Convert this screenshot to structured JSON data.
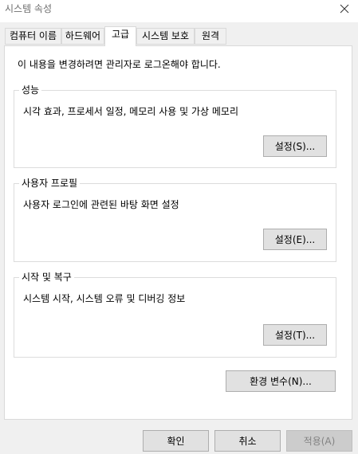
{
  "window": {
    "title": "시스템 속성"
  },
  "tabs": [
    {
      "label": "컴퓨터 이름"
    },
    {
      "label": "하드웨어"
    },
    {
      "label": "고급"
    },
    {
      "label": "시스템 보호"
    },
    {
      "label": "원격"
    }
  ],
  "active_tab": "고급",
  "notice": "이 내용을 변경하려면 관리자로 로그온해야 합니다.",
  "groups": {
    "performance": {
      "title": "성능",
      "description": "시각 효과, 프로세서 일정, 메모리 사용 및 가상 메모리",
      "button": "설정(S)..."
    },
    "user_profiles": {
      "title": "사용자 프로필",
      "description": "사용자 로그인에 관련된 바탕 화면 설정",
      "button": "설정(E)..."
    },
    "startup_recovery": {
      "title": "시작 및 복구",
      "description": "시스템 시작, 시스템 오류 및 디버깅 정보",
      "button": "설정(T)..."
    }
  },
  "env_button": "환경 변수(N)...",
  "footer": {
    "ok": "확인",
    "cancel": "취소",
    "apply": "적용(A)"
  },
  "colors": {
    "window_bg": "#f0f0f0",
    "panel_bg": "#ffffff",
    "button_bg": "#e1e1e1",
    "border": "#adadad",
    "disabled_text": "#838383"
  },
  "icons": {
    "close": "close-icon"
  }
}
